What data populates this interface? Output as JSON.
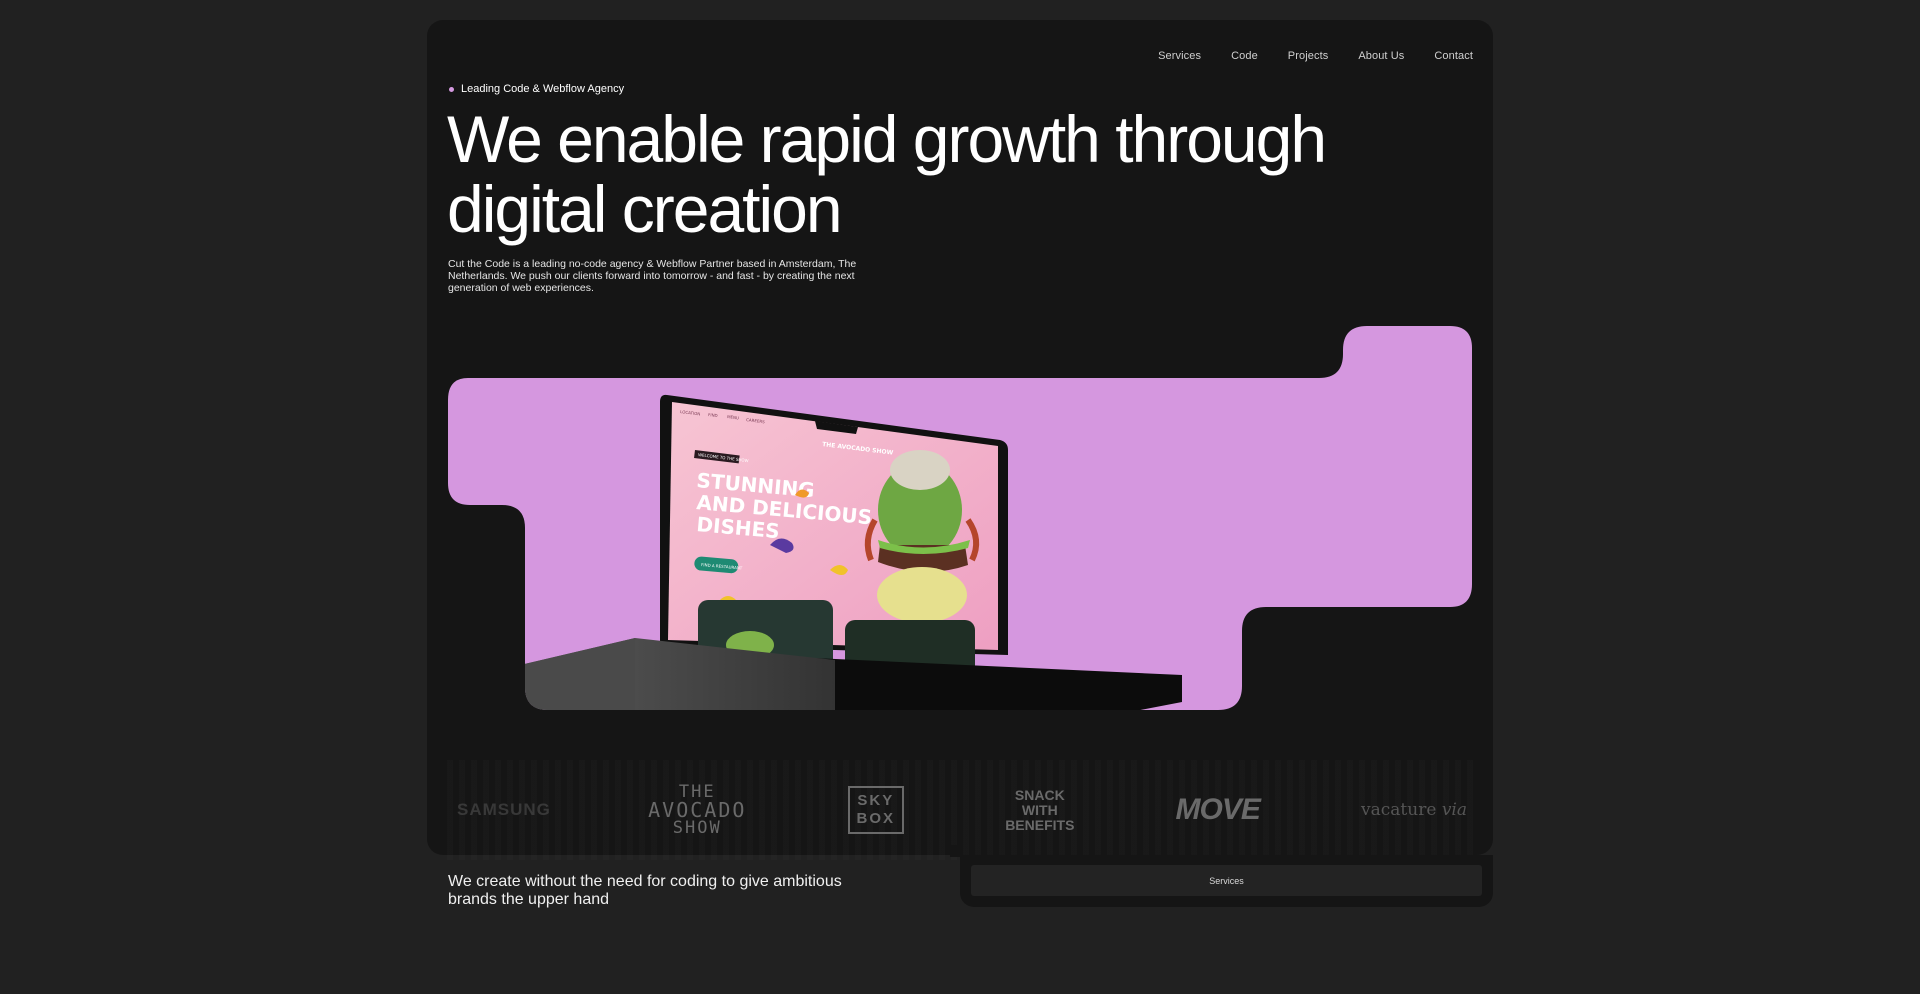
{
  "nav": {
    "items": [
      "Services",
      "Code",
      "Projects",
      "About Us",
      "Contact"
    ]
  },
  "hero": {
    "eyebrow": "Leading Code & Webflow Agency",
    "title": "We enable rapid growth through digital creation",
    "description": "Cut the Code is a leading no-code agency & Webflow Partner based in Amsterdam, The Netherlands. We push our clients forward into tomorrow - and fast - by creating the next generation of web experiences."
  },
  "laptop_screen": {
    "nav": [
      "LOCATION",
      "FIND",
      "MENU",
      "CAREERS"
    ],
    "brand": "THE AVOCADO SHOW",
    "badge": "WELCOME TO THE SHOW",
    "headline": [
      "STUNNING",
      "AND DELICIOUS",
      "DISHES"
    ],
    "cta": "FIND A RESTAURANT"
  },
  "logos": {
    "samsung": "SAMSUNG",
    "avocado": [
      "THE",
      "AVOCADO",
      "SHOW"
    ],
    "skybox": [
      "SKY",
      "BOX"
    ],
    "snack": [
      "SNACK",
      "WITH",
      "BENEFITS"
    ],
    "move": "MOVE",
    "vacature": [
      "vacature",
      "via"
    ]
  },
  "bottom": {
    "tagline": "We create without the need for coding to give ambitious brands the upper hand",
    "services_label": "Services"
  },
  "colors": {
    "page_bg": "#212121",
    "card_bg": "#151515",
    "accent_pink": "#d597df",
    "screen_pink": "#f3b9cc",
    "avocado_green": "#6ea743"
  }
}
